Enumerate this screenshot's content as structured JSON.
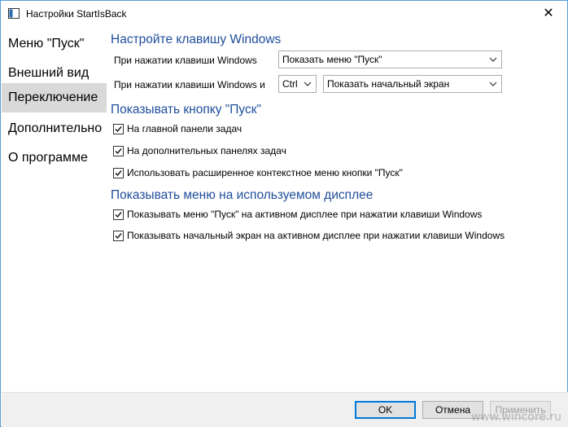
{
  "window": {
    "title": "Настройки StartIsBack",
    "close_glyph": "✕"
  },
  "sidebar": {
    "items": [
      {
        "label": "Меню \"Пуск\""
      },
      {
        "label": "Внешний вид"
      },
      {
        "label": "Переключение"
      },
      {
        "label": "Дополнительно"
      },
      {
        "label": "О программе"
      }
    ],
    "selected_index": 2
  },
  "sections": {
    "windows_key": {
      "title": "Настройте клавишу Windows",
      "row1_label": "При нажатии клавиши Windows",
      "row1_value": "Показать меню \"Пуск\"",
      "row2_label": "При нажатии клавиши Windows и",
      "row2_modifier": "Ctrl",
      "row2_value": "Показать начальный экран"
    },
    "start_button": {
      "title": "Показывать кнопку \"Пуск\"",
      "options": [
        {
          "label": "На главной панели задач",
          "checked": true
        },
        {
          "label": "На дополнительных панелях задач",
          "checked": true
        },
        {
          "label": "Использовать расширенное контекстное меню кнопки \"Пуск\"",
          "checked": true
        }
      ]
    },
    "active_display": {
      "title": "Показывать меню на используемом дисплее",
      "options": [
        {
          "label": "Показывать меню \"Пуск\" на активном дисплее при нажатии клавиши Windows",
          "checked": true
        },
        {
          "label": "Показывать начальный экран на активном дисплее при нажатии клавиши Windows",
          "checked": true
        }
      ]
    }
  },
  "footer": {
    "ok_label": "OK",
    "cancel_label": "Отмена",
    "apply_label": "Применить"
  },
  "watermark": "www.wincore.ru",
  "colors": {
    "accent": "#0078d7",
    "section_title": "#1f4e9c",
    "selected_nav": "#d9d9d9"
  }
}
